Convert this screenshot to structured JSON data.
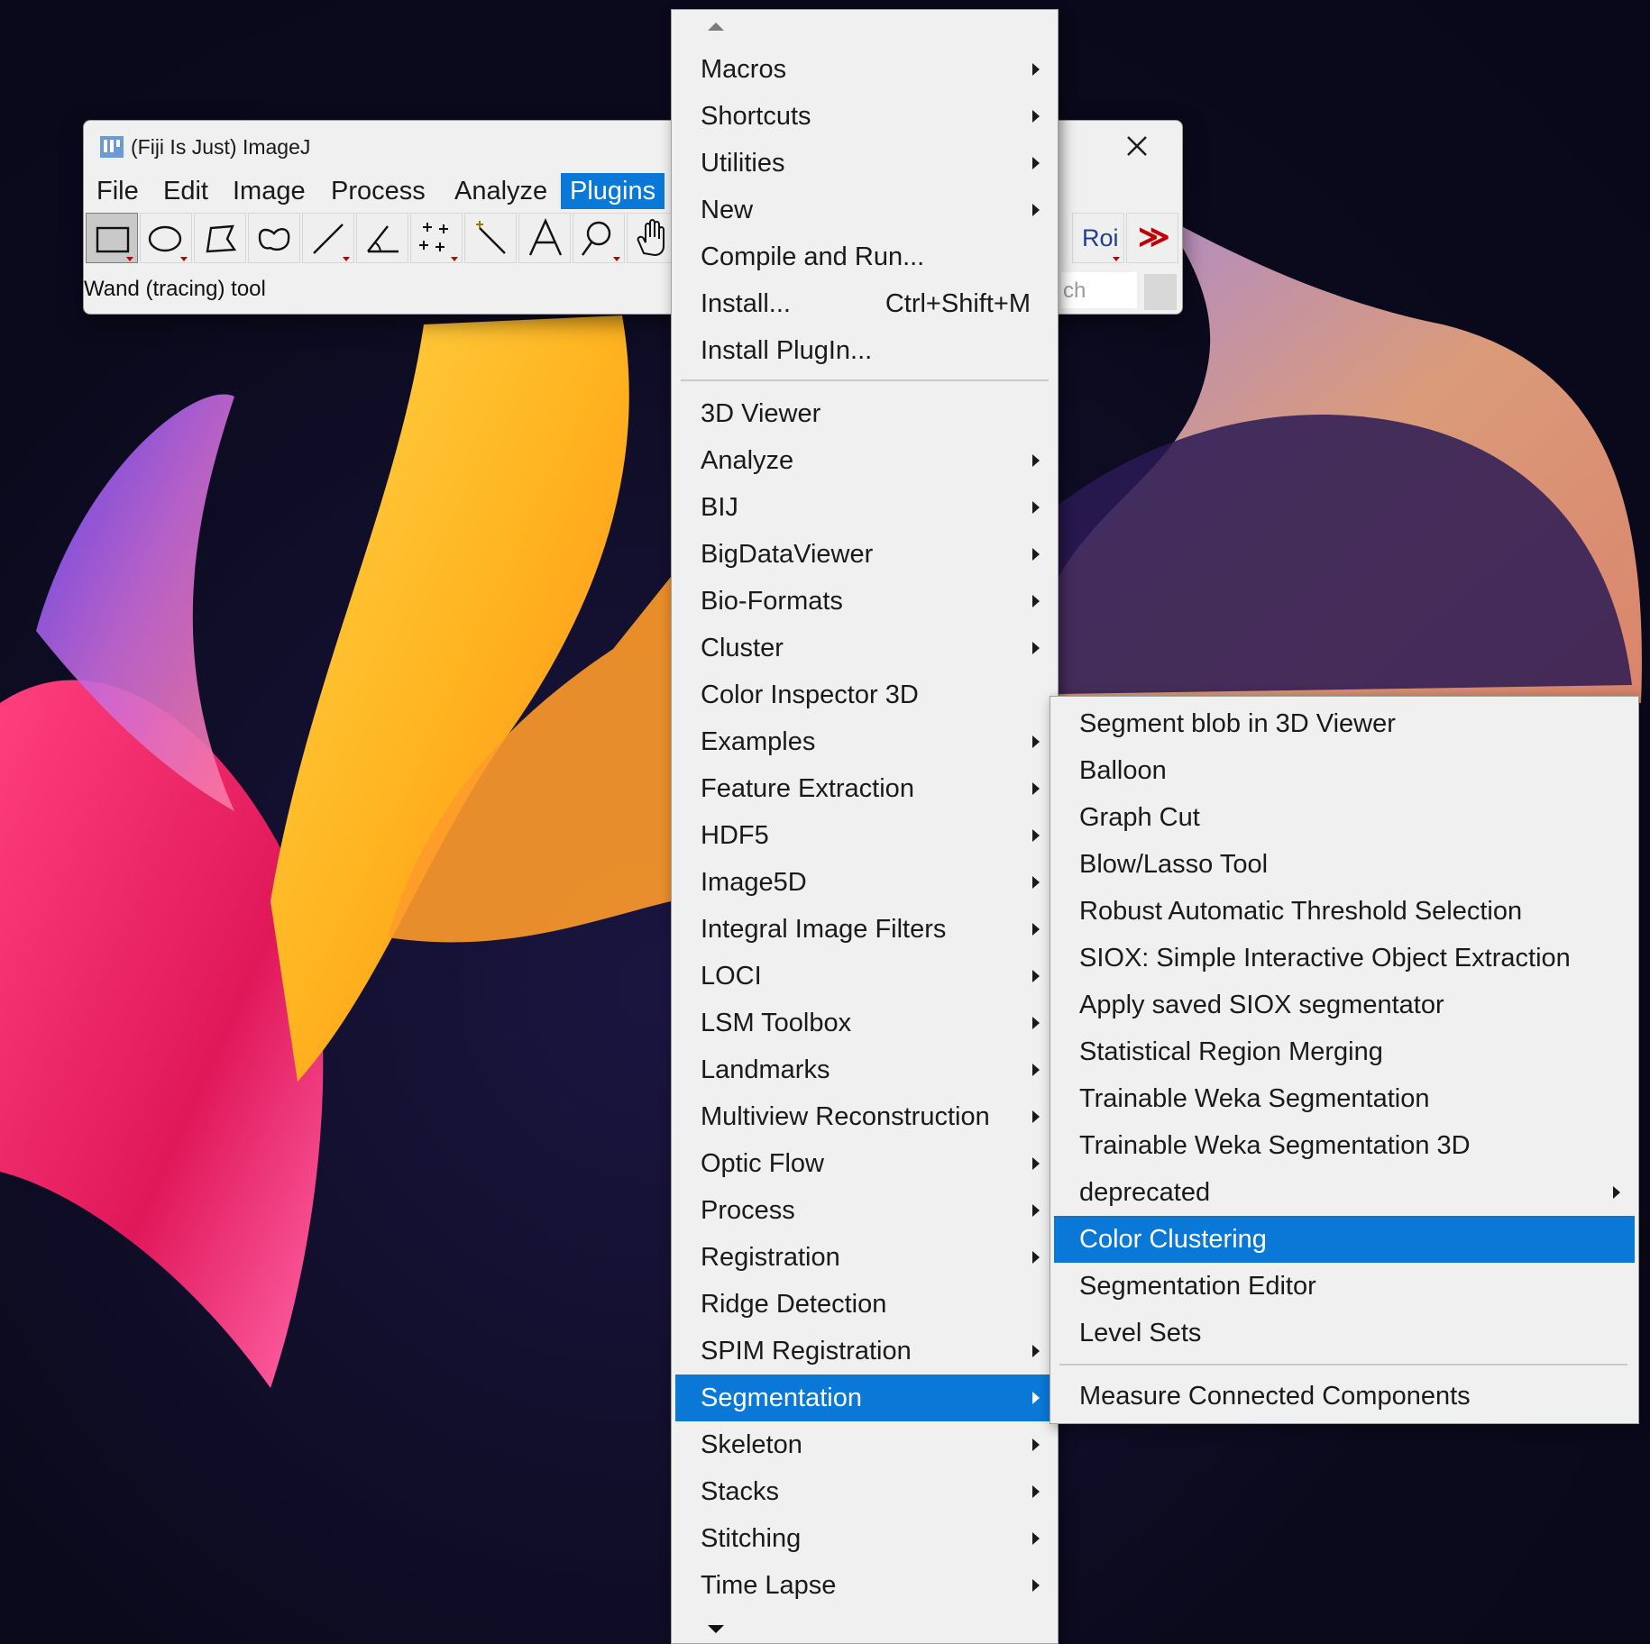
{
  "window": {
    "title": "(Fiji Is Just) ImageJ",
    "status": "Wand (tracing) tool",
    "search_placeholder": "ch"
  },
  "menubar": [
    "File",
    "Edit",
    "Image",
    "Process",
    "Analyze",
    "Plugins"
  ],
  "active_menu": "Plugins",
  "toolbar": {
    "tools": [
      "rectangle-tool",
      "oval-tool",
      "polygon-tool",
      "freehand-tool",
      "line-tool",
      "angle-tool",
      "multipoint-tool",
      "wand-tool",
      "text-tool",
      "magnifier-tool",
      "hand-tool"
    ],
    "right_tools": [
      "roi-manager-tool",
      "more-tools"
    ],
    "roi_label": "Roi",
    "more_label": "≫"
  },
  "plugins_menu": {
    "group1": [
      {
        "label": "Macros",
        "submenu": true
      },
      {
        "label": "Shortcuts",
        "submenu": true
      },
      {
        "label": "Utilities",
        "submenu": true
      },
      {
        "label": "New",
        "submenu": true
      },
      {
        "label": "Compile and Run...",
        "submenu": false
      },
      {
        "label": "Install...",
        "shortcut": "Ctrl+Shift+M",
        "submenu": false
      },
      {
        "label": "Install PlugIn...",
        "submenu": false
      }
    ],
    "group2": [
      {
        "label": "3D Viewer",
        "submenu": false
      },
      {
        "label": "Analyze",
        "submenu": true
      },
      {
        "label": "BIJ",
        "submenu": true
      },
      {
        "label": "BigDataViewer",
        "submenu": true
      },
      {
        "label": "Bio-Formats",
        "submenu": true
      },
      {
        "label": "Cluster",
        "submenu": true
      },
      {
        "label": "Color Inspector 3D",
        "submenu": false
      },
      {
        "label": "Examples",
        "submenu": true
      },
      {
        "label": "Feature Extraction",
        "submenu": true
      },
      {
        "label": "HDF5",
        "submenu": true
      },
      {
        "label": "Image5D",
        "submenu": true
      },
      {
        "label": "Integral Image Filters",
        "submenu": true
      },
      {
        "label": "LOCI",
        "submenu": true
      },
      {
        "label": "LSM Toolbox",
        "submenu": true
      },
      {
        "label": "Landmarks",
        "submenu": true
      },
      {
        "label": "Multiview Reconstruction",
        "submenu": true
      },
      {
        "label": "Optic Flow",
        "submenu": true
      },
      {
        "label": "Process",
        "submenu": true
      },
      {
        "label": "Registration",
        "submenu": true
      },
      {
        "label": "Ridge Detection",
        "submenu": false
      },
      {
        "label": "SPIM Registration",
        "submenu": true
      },
      {
        "label": "Segmentation",
        "submenu": true,
        "highlighted": true
      },
      {
        "label": "Skeleton",
        "submenu": true
      },
      {
        "label": "Stacks",
        "submenu": true
      },
      {
        "label": "Stitching",
        "submenu": true
      },
      {
        "label": "Time Lapse",
        "submenu": true
      }
    ]
  },
  "segmentation_submenu": {
    "group1": [
      {
        "label": "Segment blob in 3D Viewer",
        "submenu": false
      },
      {
        "label": "Balloon",
        "submenu": false
      },
      {
        "label": "Graph Cut",
        "submenu": false
      },
      {
        "label": "Blow/Lasso Tool",
        "submenu": false
      },
      {
        "label": "Robust Automatic Threshold Selection",
        "submenu": false
      },
      {
        "label": "SIOX: Simple Interactive Object Extraction",
        "submenu": false
      },
      {
        "label": "Apply saved SIOX segmentator",
        "submenu": false
      },
      {
        "label": "Statistical Region Merging",
        "submenu": false
      },
      {
        "label": "Trainable Weka Segmentation",
        "submenu": false
      },
      {
        "label": "Trainable Weka Segmentation 3D",
        "submenu": false
      },
      {
        "label": "deprecated",
        "submenu": true
      },
      {
        "label": "Color Clustering",
        "submenu": false,
        "highlighted": true
      },
      {
        "label": "Segmentation Editor",
        "submenu": false
      },
      {
        "label": "Level Sets",
        "submenu": false
      }
    ],
    "group2": [
      {
        "label": "Measure Connected Components",
        "submenu": false
      }
    ]
  },
  "colors": {
    "highlight": "#0a78d7",
    "menu_bg": "#f0f0f0"
  }
}
